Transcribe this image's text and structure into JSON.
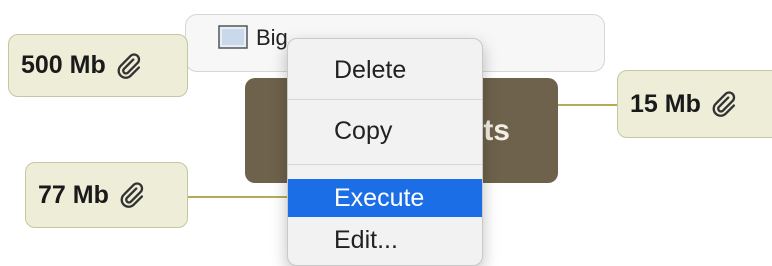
{
  "tags": {
    "top_left": "500 Mb",
    "right": "15 Mb",
    "bottom_left": "77 Mb"
  },
  "file_item": {
    "label": "Big"
  },
  "central_node": {
    "label": "ts"
  },
  "menu": {
    "items": [
      "Delete",
      "Copy",
      "Execute",
      "Edit..."
    ],
    "active_item": "Execute"
  },
  "colors": {
    "tag_fill": "#eeeed8",
    "connector": "#b5ad55",
    "central_node": "#6f624c",
    "menu_highlight": "#1c6ee6"
  },
  "icons": [
    "paperclip-icon",
    "file-icon"
  ]
}
